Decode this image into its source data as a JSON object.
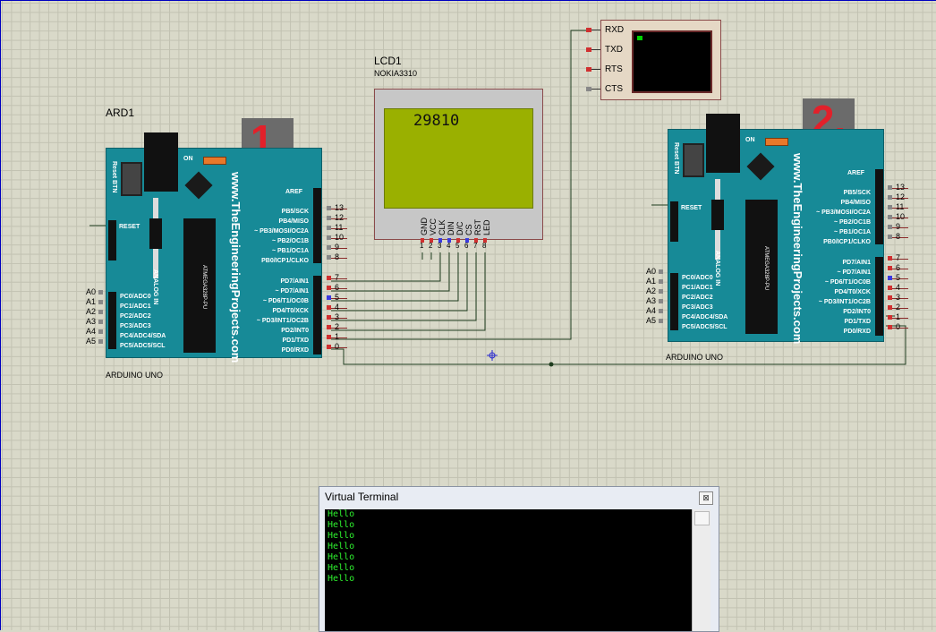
{
  "lcd": {
    "ref": "LCD1",
    "model": "NOKIA3310",
    "value": "29810",
    "pins": [
      "GND",
      "VCC",
      "CLK",
      "DIN",
      "D/C",
      "CS",
      "RST",
      "LED"
    ],
    "pin_numbers": [
      "1",
      "2",
      "3",
      "4",
      "5",
      "6",
      "7",
      "8"
    ]
  },
  "ard1": {
    "ref": "ARD1",
    "type": "ARDUINO UNO",
    "badge": "1."
  },
  "ard2": {
    "type": "ARDUINO UNO",
    "badge": "2."
  },
  "board": {
    "url": "www.TheEngineeringProjects.com",
    "chip": "ATMEGA328P-PU",
    "chip_code": "1121",
    "reset_btn": "Reset BTN",
    "on": "ON",
    "reset": "RESET",
    "analog_in": "ANALOG IN",
    "aref": "AREF",
    "digital_top": [
      [
        "PB5/SCK",
        "13"
      ],
      [
        "PB4/MISO",
        "12"
      ],
      [
        "~ PB3/MOSI/OC2A",
        "11"
      ],
      [
        "~ PB2/OC1B",
        "10"
      ],
      [
        "~ PB1/OC1A",
        "9"
      ],
      [
        "PB0/ICP1/CLKO",
        "8"
      ]
    ],
    "digital_bottom": [
      [
        "PD7/AIN1",
        "7"
      ],
      [
        "~ PD7/AIN1",
        "6"
      ],
      [
        "~ PD6/T1/OC0B",
        "5"
      ],
      [
        "PD4/T0/XCK",
        "4"
      ],
      [
        "~ PD3/INT1/OC2B",
        "3"
      ],
      [
        "PD2/INT0",
        "2"
      ],
      [
        "PD1/TXD",
        "1"
      ],
      [
        "PD0/RXD",
        "0"
      ]
    ],
    "analog": [
      [
        "A0",
        "PC0/ADC0"
      ],
      [
        "A1",
        "PC1/ADC1"
      ],
      [
        "A2",
        "PC2/ADC2"
      ],
      [
        "A3",
        "PC3/ADC3"
      ],
      [
        "A4",
        "PC4/ADC4/SDA"
      ],
      [
        "A5",
        "PC5/ADC5/SCL"
      ]
    ]
  },
  "serial_box": {
    "pins": [
      "RXD",
      "TXD",
      "RTS",
      "CTS"
    ]
  },
  "terminal": {
    "title": "Virtual Terminal",
    "close": "⊠",
    "lines": [
      "Hello",
      "Hello",
      "Hello",
      "Hello",
      "Hello",
      "Hello",
      "Hello"
    ]
  },
  "colors": {
    "board": "#178a97",
    "lcd_screen": "#9ab000",
    "badge_text": "#e2202a",
    "wire": "#1c4a1c",
    "terminal_text": "#2ef02e"
  }
}
